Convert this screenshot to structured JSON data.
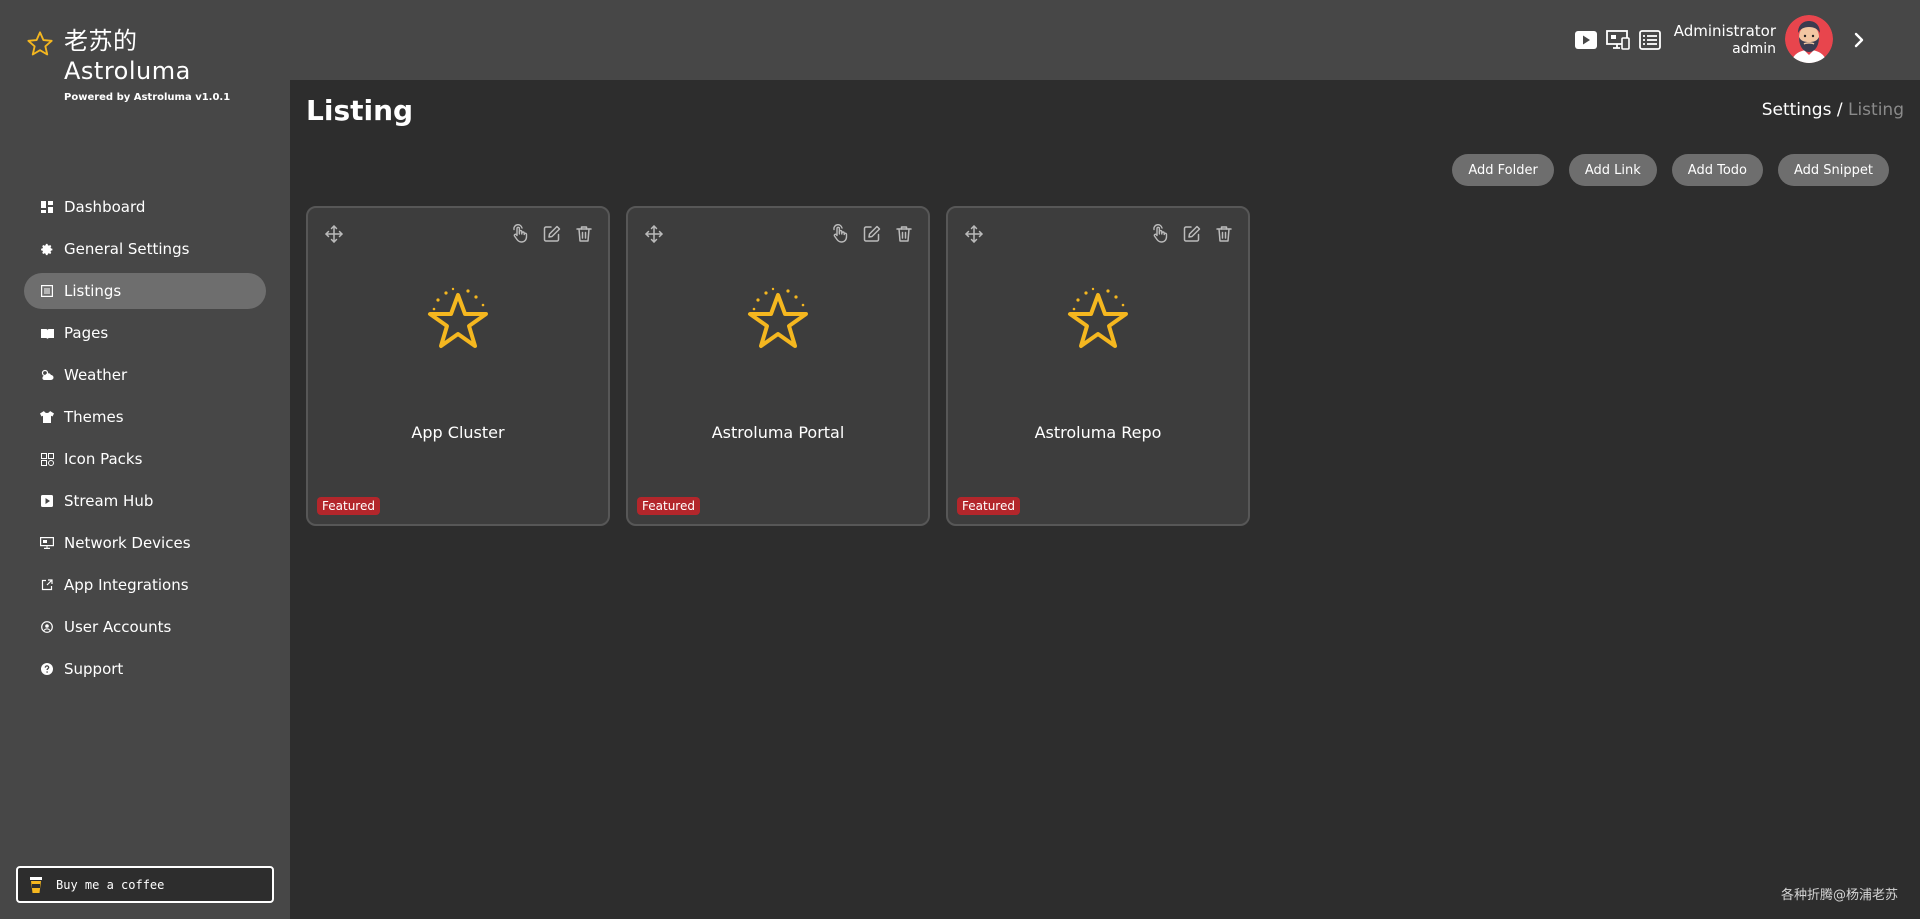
{
  "brand": {
    "title_line1": "老苏的",
    "title_line2": "Astroluma",
    "subtitle": "Powered by Astroluma v1.0.1",
    "logo_icon": "star-icon"
  },
  "sidebar": {
    "items": [
      {
        "label": "Dashboard",
        "icon": "dashboard-icon"
      },
      {
        "label": "General Settings",
        "icon": "gear-icon"
      },
      {
        "label": "Listings",
        "icon": "list-icon",
        "active": true
      },
      {
        "label": "Pages",
        "icon": "book-icon"
      },
      {
        "label": "Weather",
        "icon": "weather-icon"
      },
      {
        "label": "Themes",
        "icon": "shirt-icon"
      },
      {
        "label": "Icon Packs",
        "icon": "icon-packs-icon"
      },
      {
        "label": "Stream Hub",
        "icon": "play-icon"
      },
      {
        "label": "Network Devices",
        "icon": "monitor-icon"
      },
      {
        "label": "App Integrations",
        "icon": "external-link-icon"
      },
      {
        "label": "User Accounts",
        "icon": "user-circle-icon"
      },
      {
        "label": "Support",
        "icon": "question-icon"
      }
    ],
    "coffee_label": "Buy me a coffee"
  },
  "header": {
    "user_name": "Administrator",
    "user_role": "admin",
    "icons": [
      "youtube-icon",
      "devices-icon",
      "list-view-icon"
    ]
  },
  "page": {
    "title": "Listing",
    "breadcrumb_parent": "Settings /",
    "breadcrumb_current": "Listing",
    "actions": {
      "add_folder": "Add Folder",
      "add_link": "Add Link",
      "add_todo": "Add Todo",
      "add_snippet": "Add Snippet"
    }
  },
  "cards": [
    {
      "name": "App Cluster",
      "badge": "Featured"
    },
    {
      "name": "Astroluma Portal",
      "badge": "Featured"
    },
    {
      "name": "Astroluma Repo",
      "badge": "Featured"
    }
  ],
  "footer_note": "各种折腾@杨浦老苏",
  "colors": {
    "accent_star": "#f5b71f",
    "badge": "#b3262b",
    "sidebar_bg": "#474747",
    "page_bg": "#2d2d2d"
  }
}
